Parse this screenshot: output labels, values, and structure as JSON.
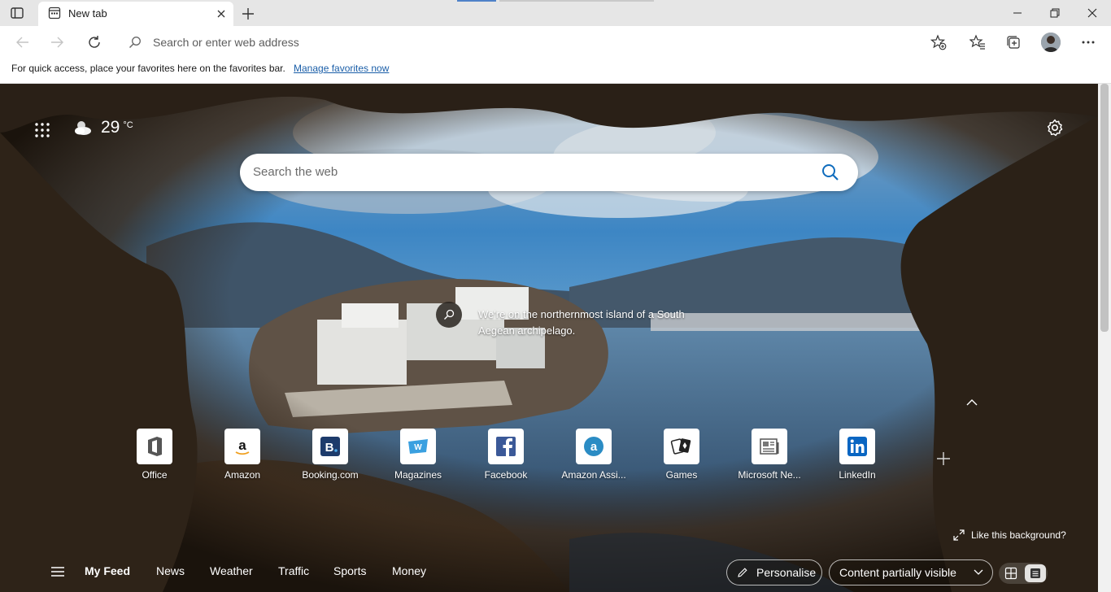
{
  "browser": {
    "tab": {
      "title": "New tab"
    },
    "address_bar": {
      "placeholder": "Search or enter web address"
    },
    "favorites_bar": {
      "message": "For quick access, place your favorites here on the favorites bar.",
      "link": "Manage favorites now"
    }
  },
  "ntp": {
    "weather": {
      "temperature": "29",
      "unit": "°C",
      "icon": "partly-cloudy-icon"
    },
    "search": {
      "placeholder": "Search the web"
    },
    "background_info": {
      "caption": "We're on the northernmost island of a South Aegean archipelago."
    },
    "quick_links": [
      {
        "label": "Office",
        "icon": "office-icon"
      },
      {
        "label": "Amazon",
        "icon": "amazon-icon"
      },
      {
        "label": "Booking.com",
        "icon": "booking-icon"
      },
      {
        "label": "Magazines",
        "icon": "magazines-icon"
      },
      {
        "label": "Facebook",
        "icon": "facebook-icon"
      },
      {
        "label": "Amazon Assi...",
        "icon": "amazon-assistant-icon"
      },
      {
        "label": "Games",
        "icon": "games-icon"
      },
      {
        "label": "Microsoft Ne...",
        "icon": "microsoft-news-icon"
      },
      {
        "label": "LinkedIn",
        "icon": "linkedin-icon"
      }
    ],
    "like_background": "Like this background?",
    "feed": {
      "tabs": [
        "My Feed",
        "News",
        "Weather",
        "Traffic",
        "Sports",
        "Money"
      ],
      "personalise": "Personalise",
      "content_visibility": "Content partially visible"
    }
  },
  "colors": {
    "accent_link": "#1a5ea8",
    "search_icon": "#0f6cbd"
  }
}
